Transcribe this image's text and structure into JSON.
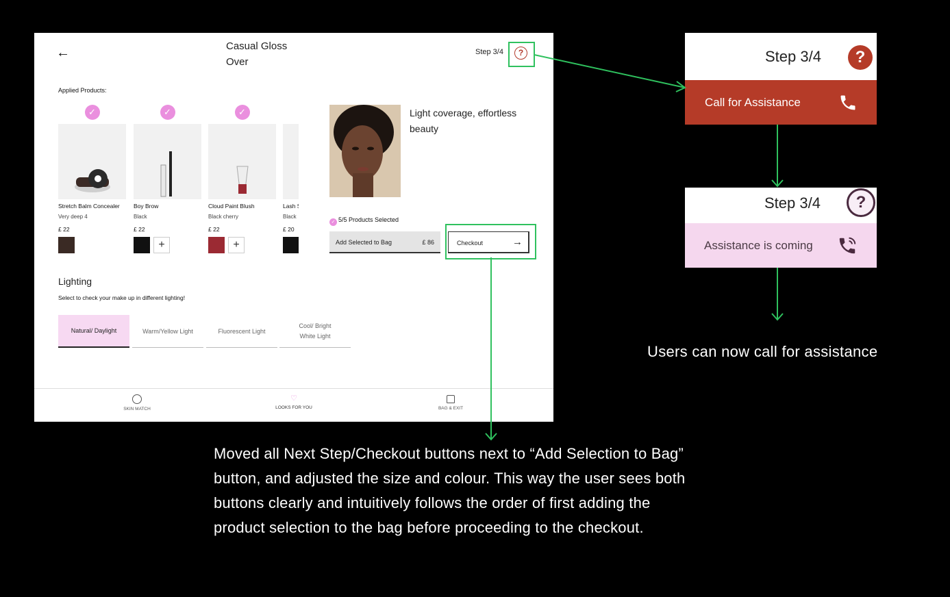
{
  "app": {
    "title": "Casual Gloss Over",
    "step_label": "Step 3/4",
    "help_icon": "question-circle-icon",
    "applied_label": "Applied Products:",
    "products": [
      {
        "name": "Stretch Balm Concealer",
        "shade": "Very deep 4",
        "price": "£ 22",
        "swatch": "#3a2a24",
        "add": false
      },
      {
        "name": "Boy Brow",
        "shade": "Black",
        "price": "£ 22",
        "swatch": "#111111",
        "add": true
      },
      {
        "name": "Cloud Paint Blush",
        "shade": "Black cherry",
        "price": "£ 22",
        "swatch": "#9b2a33",
        "add": true
      },
      {
        "name": "Lash Slick",
        "shade": "Black",
        "price": "£ 20",
        "swatch": "#111111",
        "add": false
      }
    ],
    "look_description": "Light coverage, effortless beauty",
    "selected_count": "5/5 Products Selected",
    "add_to_bag_label": "Add Selected to Bag",
    "add_to_bag_price": "£ 86",
    "checkout_label": "Checkout",
    "lighting_title": "Lighting",
    "lighting_subtitle": "Select to check your make up in different lighting!",
    "lighting_options": [
      "Natural/ Daylight",
      "Warm/Yellow Light",
      "Fluorescent Light",
      "Cool/ Bright White Light"
    ],
    "lighting_selected": 0,
    "nav": [
      {
        "label": "SKIN MATCH",
        "icon": "circle-icon"
      },
      {
        "label": "LOOKS FOR YOU",
        "icon": "lips-icon"
      },
      {
        "label": "BAG & EXIT",
        "icon": "bag-icon"
      }
    ]
  },
  "card1": {
    "step_label": "Step 3/4",
    "button_label": "Call for Assistance",
    "accent": "#b53b28"
  },
  "card2": {
    "step_label": "Step 3/4",
    "button_label": "Assistance is coming",
    "accent": "#f5d7ee"
  },
  "annotations": {
    "right": "Users can now call for assistance",
    "bottom": "Moved all Next Step/Checkout buttons next to “Add Selection to Bag” button, and adjusted the size and colour. This way the user sees both buttons clearly and intuitively follows the order of first adding the product selection to the bag before proceeding to the checkout."
  },
  "colors": {
    "annotation_arrow": "#2fc15e",
    "pink_accent": "#ea8fde"
  }
}
